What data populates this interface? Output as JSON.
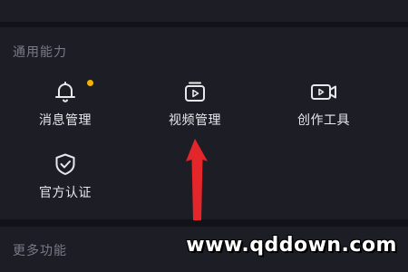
{
  "section": {
    "title": "通用能力",
    "items": [
      {
        "label": "消息管理",
        "icon": "bell-icon",
        "badge": true
      },
      {
        "label": "视频管理",
        "icon": "video-folder-icon",
        "badge": false
      },
      {
        "label": "创作工具",
        "icon": "camera-icon",
        "badge": false
      },
      {
        "label": "官方认证",
        "icon": "shield-check-icon",
        "badge": false
      }
    ]
  },
  "more": {
    "title": "更多功能"
  },
  "watermark": "www.qddown.com",
  "colors": {
    "background": "#16161e",
    "card": "#1d1d26",
    "badge": "#f4b400",
    "arrow": "#e3262a"
  }
}
